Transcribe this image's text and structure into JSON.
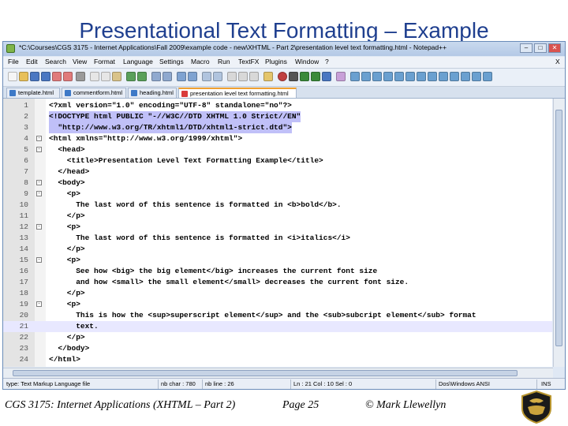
{
  "slide": {
    "title": "Presentational Text Formatting – Example"
  },
  "window": {
    "title": "*C:\\Courses\\CGS 3175 - Internet Applications\\Fall 2009\\example code - new\\XHTML - Part 2\\presentation level text formatting.html - Notepad++",
    "controls": [
      "–",
      "□",
      "✕"
    ]
  },
  "menu": [
    "File",
    "Edit",
    "Search",
    "View",
    "Format",
    "Language",
    "Settings",
    "Macro",
    "Run",
    "TextFX",
    "Plugins",
    "Window",
    "?"
  ],
  "menu_close": "X",
  "tabs": [
    {
      "label": "template.html",
      "active": false
    },
    {
      "label": "commentform.html",
      "active": false
    },
    {
      "label": "heading.html",
      "active": false
    },
    {
      "label": "presentation level text formatting.html",
      "active": true
    }
  ],
  "code_lines": [
    {
      "no": "1",
      "text": "<?xml version=\"1.0\" encoding=\"UTF-8\" standalone=\"no\"?>",
      "fold": ""
    },
    {
      "no": "2",
      "text": "<!DOCTYPE html PUBLIC \"-//W3C//DTD XHTML 1.0 Strict//EN\"",
      "fold": "",
      "selected": true
    },
    {
      "no": "3",
      "text": "  \"http://www.w3.org/TR/xhtml1/DTD/xhtml1-strict.dtd\">",
      "fold": "",
      "selected": true
    },
    {
      "no": "4",
      "text": "<html xmlns=\"http://www.w3.org/1999/xhtml\">",
      "fold": "-"
    },
    {
      "no": "5",
      "text": "  <head>",
      "fold": "-"
    },
    {
      "no": "6",
      "text": "    <title>Presentation Level Text Formatting Example</title>",
      "fold": ""
    },
    {
      "no": "7",
      "text": "  </head>",
      "fold": ""
    },
    {
      "no": "8",
      "text": "  <body>",
      "fold": "-"
    },
    {
      "no": "9",
      "text": "    <p>",
      "fold": "-"
    },
    {
      "no": "10",
      "text": "      The last word of this sentence is formatted in <b>bold</b>.",
      "fold": ""
    },
    {
      "no": "11",
      "text": "    </p>",
      "fold": ""
    },
    {
      "no": "12",
      "text": "    <p>",
      "fold": "-"
    },
    {
      "no": "13",
      "text": "      The last word of this sentence is formatted in <i>italics</i>",
      "fold": ""
    },
    {
      "no": "14",
      "text": "    </p>",
      "fold": ""
    },
    {
      "no": "15",
      "text": "    <p>",
      "fold": "-"
    },
    {
      "no": "16",
      "text": "      See how <big> the big element</big> increases the current font size",
      "fold": ""
    },
    {
      "no": "17",
      "text": "      and how <small> the small element</small> decreases the current font size.",
      "fold": ""
    },
    {
      "no": "18",
      "text": "    </p>",
      "fold": ""
    },
    {
      "no": "19",
      "text": "    <p>",
      "fold": "-"
    },
    {
      "no": "20",
      "text": "      This is how the <sup>superscript element</sup> and the <sub>subcript element</sub> format",
      "fold": ""
    },
    {
      "no": "21",
      "text": "      text.",
      "fold": "",
      "current": true
    },
    {
      "no": "22",
      "text": "    </p>",
      "fold": ""
    },
    {
      "no": "23",
      "text": "  </body>",
      "fold": ""
    },
    {
      "no": "24",
      "text": "</html>",
      "fold": ""
    }
  ],
  "status": {
    "type": "type: Text Markup Language file",
    "chars": "nb char : 780",
    "lines": "nb line : 26",
    "position": "Ln : 21    Col : 10    Sel : 0",
    "eol": "Dos\\Windows  ANSI",
    "mode": "INS"
  },
  "footer": {
    "course": "CGS 3175: Internet Applications (XHTML – Part 2)",
    "page": "Page 25",
    "author": "© Mark Llewellyn"
  }
}
